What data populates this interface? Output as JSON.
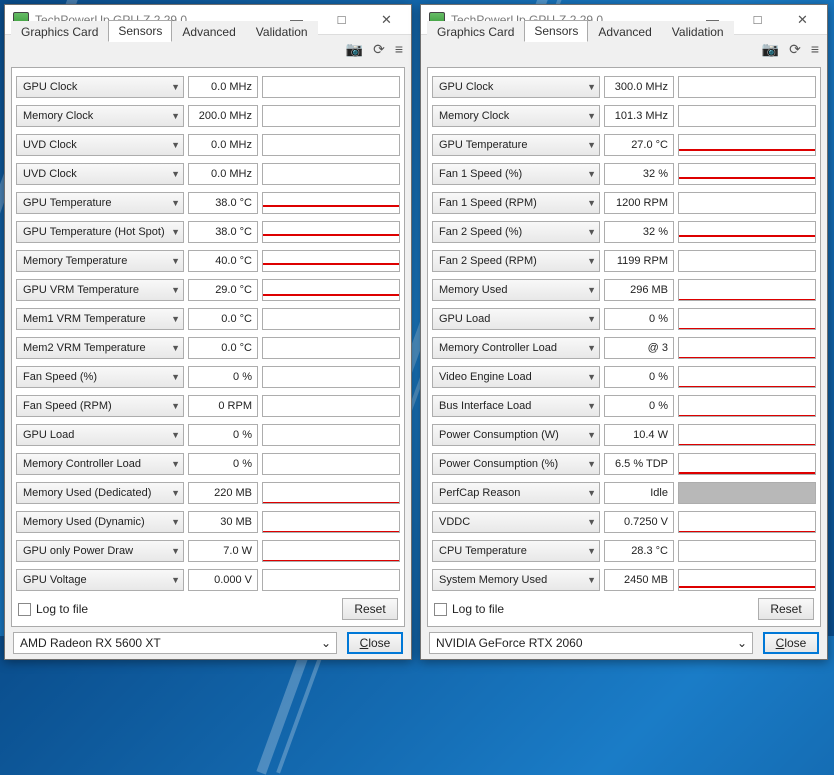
{
  "app_title": "TechPowerUp GPU-Z 2.29.0",
  "tabs": [
    "Graphics Card",
    "Sensors",
    "Advanced",
    "Validation"
  ],
  "active_tab": "Sensors",
  "log_label": "Log to file",
  "reset_label": "Reset",
  "close_label": "Close",
  "left": {
    "gpu_name": "AMD Radeon RX 5600 XT",
    "sensors": [
      {
        "label": "GPU Clock",
        "value": "0.0 MHz",
        "bar": null
      },
      {
        "label": "Memory Clock",
        "value": "200.0 MHz",
        "bar": null
      },
      {
        "label": "UVD Clock",
        "value": "0.0 MHz",
        "bar": null
      },
      {
        "label": "UVD Clock",
        "value": "0.0 MHz",
        "bar": null
      },
      {
        "label": "GPU Temperature",
        "value": "38.0 °C",
        "bar": 62
      },
      {
        "label": "GPU Temperature (Hot Spot)",
        "value": "38.0 °C",
        "bar": 62
      },
      {
        "label": "Memory Temperature",
        "value": "40.0 °C",
        "bar": 60
      },
      {
        "label": "GPU VRM Temperature",
        "value": "29.0 °C",
        "bar": 71
      },
      {
        "label": "Mem1 VRM Temperature",
        "value": "0.0 °C",
        "bar": null
      },
      {
        "label": "Mem2 VRM Temperature",
        "value": "0.0 °C",
        "bar": null
      },
      {
        "label": "Fan Speed (%)",
        "value": "0 %",
        "bar": null
      },
      {
        "label": "Fan Speed (RPM)",
        "value": "0 RPM",
        "bar": null
      },
      {
        "label": "GPU Load",
        "value": "0 %",
        "bar": null
      },
      {
        "label": "Memory Controller Load",
        "value": "0 %",
        "bar": null
      },
      {
        "label": "Memory Used (Dedicated)",
        "value": "220 MB",
        "bar": 98
      },
      {
        "label": "Memory Used (Dynamic)",
        "value": "30 MB",
        "bar": 98
      },
      {
        "label": "GPU only Power Draw",
        "value": "7.0 W",
        "bar": 98
      },
      {
        "label": "GPU Voltage",
        "value": "0.000 V",
        "bar": null
      }
    ]
  },
  "right": {
    "gpu_name": "NVIDIA GeForce RTX 2060",
    "sensors": [
      {
        "label": "GPU Clock",
        "value": "300.0 MHz",
        "bar": null
      },
      {
        "label": "Memory Clock",
        "value": "101.3 MHz",
        "bar": null
      },
      {
        "label": "GPU Temperature",
        "value": "27.0 °C",
        "bar": 73
      },
      {
        "label": "Fan 1 Speed (%)",
        "value": "32 %",
        "bar": 68
      },
      {
        "label": "Fan 1 Speed (RPM)",
        "value": "1200 RPM",
        "bar": null
      },
      {
        "label": "Fan 2 Speed (%)",
        "value": "32 %",
        "bar": 68
      },
      {
        "label": "Fan 2 Speed (RPM)",
        "value": "1199 RPM",
        "bar": null
      },
      {
        "label": "Memory Used",
        "value": "296 MB",
        "bar": 96
      },
      {
        "label": "GPU Load",
        "value": "0 %",
        "bar": 98
      },
      {
        "label": "Memory Controller Load",
        "value": "@ 3",
        "bar": 98
      },
      {
        "label": "Video Engine Load",
        "value": "0 %",
        "bar": 98
      },
      {
        "label": "Bus Interface Load",
        "value": "0 %",
        "bar": 98
      },
      {
        "label": "Power Consumption (W)",
        "value": "10.4 W",
        "bar": 96
      },
      {
        "label": "Power Consumption (%)",
        "value": "6.5 % TDP",
        "bar": 94
      },
      {
        "label": "PerfCap Reason",
        "value": "Idle",
        "bar": "grey"
      },
      {
        "label": "VDDC",
        "value": "0.7250 V",
        "bar": 96
      },
      {
        "label": "CPU Temperature",
        "value": "28.3 °C",
        "bar": null
      },
      {
        "label": "System Memory Used",
        "value": "2450 MB",
        "bar": 82
      }
    ]
  }
}
